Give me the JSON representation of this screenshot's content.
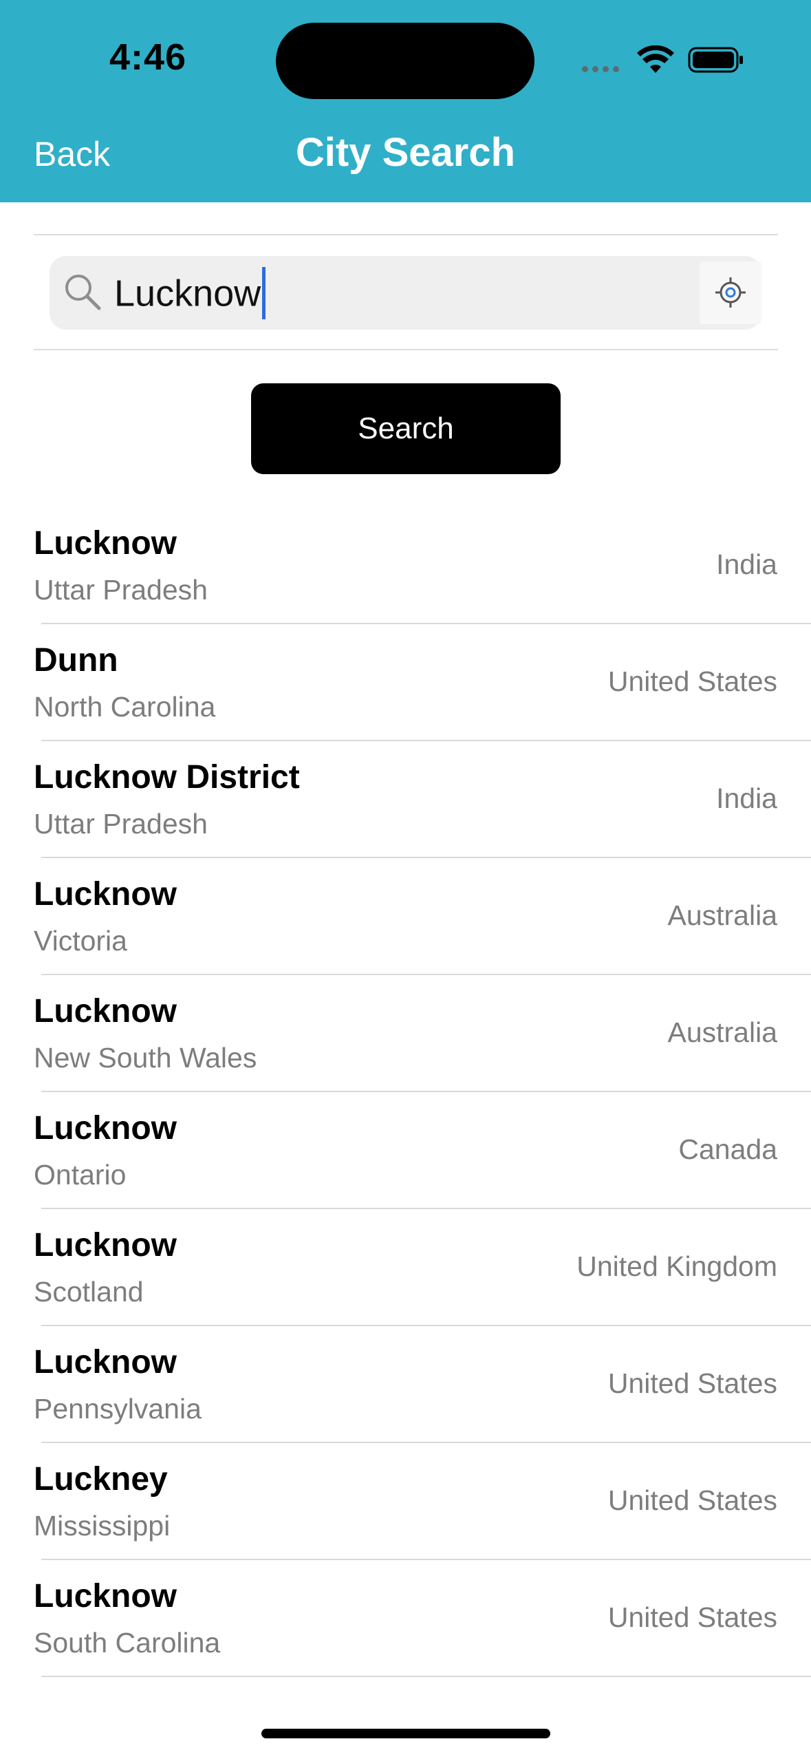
{
  "status_bar": {
    "time": "4:46"
  },
  "nav": {
    "back_label": "Back",
    "title": "City Search",
    "background_color": "#30afc8"
  },
  "search": {
    "value": "Lucknow",
    "button_label": "Search",
    "location_icon": "location-crosshair-icon",
    "search_icon": "magnifier-icon"
  },
  "results": [
    {
      "city": "Lucknow",
      "region": "Uttar Pradesh",
      "country": "India"
    },
    {
      "city": "Dunn",
      "region": "North Carolina",
      "country": "United States"
    },
    {
      "city": "Lucknow District",
      "region": "Uttar Pradesh",
      "country": "India"
    },
    {
      "city": "Lucknow",
      "region": "Victoria",
      "country": "Australia"
    },
    {
      "city": "Lucknow",
      "region": "New South Wales",
      "country": "Australia"
    },
    {
      "city": "Lucknow",
      "region": "Ontario",
      "country": "Canada"
    },
    {
      "city": "Lucknow",
      "region": "Scotland",
      "country": "United Kingdom"
    },
    {
      "city": "Lucknow",
      "region": "Pennsylvania",
      "country": "United States"
    },
    {
      "city": "Luckney",
      "region": "Mississippi",
      "country": "United States"
    },
    {
      "city": "Lucknow",
      "region": "South Carolina",
      "country": "United States"
    }
  ]
}
